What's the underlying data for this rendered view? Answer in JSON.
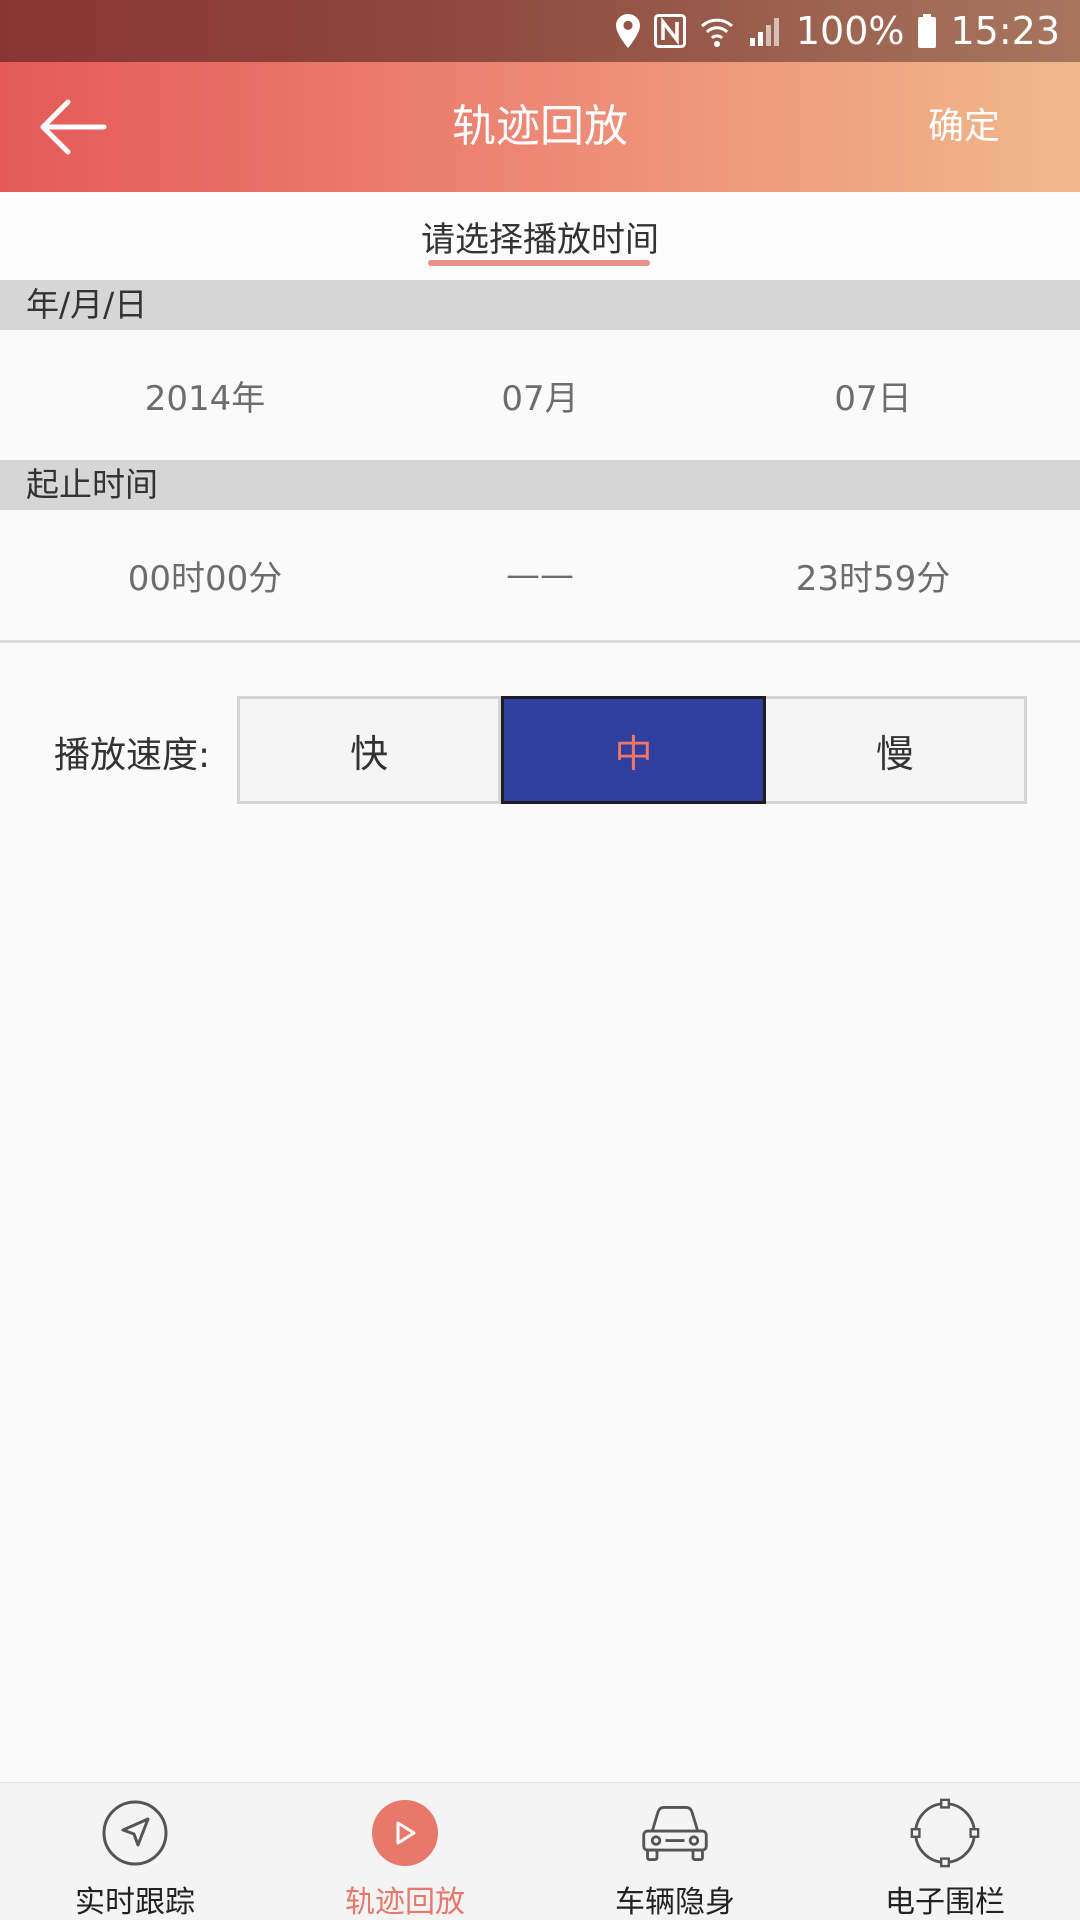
{
  "status_bar": {
    "battery": "100%",
    "time": "15:23"
  },
  "app_bar": {
    "title": "轨迹回放",
    "confirm_label": "确定"
  },
  "subtitle": "请选择播放时间",
  "date_section": {
    "header": "年/月/日",
    "year": "2014年",
    "month": "07月",
    "day": "07日"
  },
  "time_section": {
    "header": "起止时间",
    "start": "00时00分",
    "separator": "——",
    "end": "23时59分"
  },
  "speed": {
    "label": "播放速度:",
    "options": [
      "快",
      "中",
      "慢"
    ],
    "selected": "中"
  },
  "bottom_nav": {
    "items": [
      {
        "label": "实时跟踪",
        "icon": "navigation-arrow-icon"
      },
      {
        "label": "轨迹回放",
        "icon": "play-circle-icon",
        "active": true
      },
      {
        "label": "车辆隐身",
        "icon": "car-icon"
      },
      {
        "label": "电子围栏",
        "icon": "fence-circle-icon"
      }
    ]
  },
  "colors": {
    "accent": "#e8786a",
    "selected_speed_bg": "#2f3fa0",
    "header_gradient_start": "#e55a58",
    "header_gradient_end": "#f1b98b"
  }
}
